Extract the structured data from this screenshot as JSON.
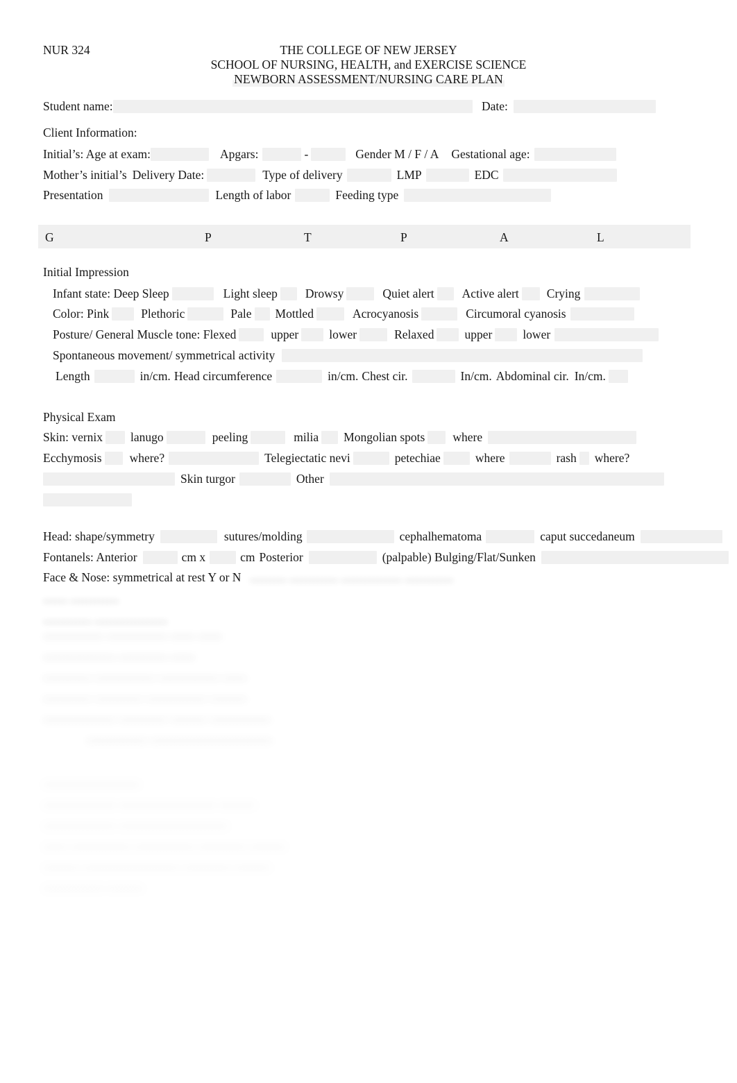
{
  "document": {
    "course_code": "NUR 324",
    "institution": "THE COLLEGE OF NEW JERSEY",
    "school": "SCHOOL OF NURSING, HEALTH, and EXERCISE SCIENCE",
    "form_title": "NEWBORN ASSESSMENT/NURSING CARE PLAN"
  },
  "student_row": {
    "student_name_label": "Student name:",
    "student_name_value": "",
    "date_label": "Date:",
    "date_value": ""
  },
  "client_information": {
    "heading": "Client Information:",
    "line1": {
      "initials_age_label": "Initial’s: Age at exam:",
      "initials_age_value": "",
      "apgars_label": "Apgars:",
      "apgars_first_value": "",
      "apgars_separator": "-",
      "apgars_second_value": "",
      "gender_label": "Gender M / F / A",
      "gestational_age_label": "Gestational age:",
      "gestational_age_value": ""
    },
    "line2": {
      "mothers_initials_label": "Mother’s initial’s",
      "mothers_initials_value": "",
      "delivery_date_label": "Delivery Date:",
      "delivery_date_value": "",
      "type_of_delivery_label": "Type of delivery",
      "type_of_delivery_value": "",
      "lmp_label": "LMP",
      "lmp_value": "",
      "edc_label": "EDC",
      "edc_value": ""
    },
    "line3": {
      "presentation_label": "Presentation",
      "presentation_value": "",
      "length_of_labor_label": "Length of labor",
      "length_of_labor_value": "",
      "feeding_type_label": "Feeding type",
      "feeding_type_value": ""
    }
  },
  "gptpal": {
    "g_label": "G",
    "p1_label": "P",
    "t_label": "T",
    "p2_label": "P",
    "a_label": "A",
    "l_label": "L",
    "g_value": "",
    "p1_value": "",
    "t_value": "",
    "p2_value": "",
    "a_value": "",
    "l_value": ""
  },
  "initial_impression": {
    "heading": "Initial Impression",
    "infant_state": {
      "label": "Infant state: Deep Sleep",
      "options": [
        "Light sleep",
        "Drowsy",
        "Quiet alert",
        "Active alert",
        "Crying"
      ]
    },
    "color": {
      "label": "Color: Pink",
      "options": [
        "Plethoric",
        "Pale",
        "Mottled",
        "Acrocyanosis",
        "Circumoral cyanosis"
      ]
    },
    "posture": {
      "label": "Posture/ General Muscle tone: Flexed",
      "options": [
        "upper",
        "lower",
        "Relaxed",
        "upper",
        "lower"
      ]
    },
    "spontaneous": {
      "label": "Spontaneous movement/ symmetrical activity",
      "value": ""
    },
    "measurements": {
      "length_label": "Length",
      "length_unit": "in/cm.",
      "head_circ_label": "Head circumference",
      "head_circ_unit": "in/cm.",
      "chest_cir_label": "Chest cir.",
      "chest_cir_unit": "In/cm.",
      "abdominal_cir_label": "Abdominal cir.",
      "abdominal_cir_unit": "In/cm."
    }
  },
  "physical_exam": {
    "heading": "Physical Exam",
    "skin_line1": {
      "label": "Skin: vernix",
      "lanugo": "lanugo",
      "peeling": "peeling",
      "milia": "milia",
      "mongolian_spots": "Mongolian spots",
      "where": "where"
    },
    "skin_line2": {
      "ecchymosis": "Ecchymosis",
      "where1": "where?",
      "telegiectatic_nevi": "Telegiectatic nevi",
      "petechiae": "petechiae",
      "where2": "where",
      "rash": "rash",
      "where3": "where?"
    },
    "skin_line3": {
      "skin_turgor": "Skin turgor",
      "other": "Other"
    },
    "head_line": {
      "label": "Head: shape/symmetry",
      "sutures_molding": "sutures/molding",
      "cephalhematoma": "cephalhematoma",
      "caput_succedaneum": "caput succedaneum"
    },
    "fontanels_line": {
      "label": "Fontanels: Anterior",
      "cm_x": "cm x",
      "cm": "cm",
      "posterior": "Posterior",
      "palpable_options": "(palpable) Bulging/Flat/Sunken"
    },
    "face_nose_line": {
      "label": "Face & Nose: symmetrical at rest Y or N"
    }
  },
  "obscured_region": {
    "note": "Remainder of the form below the Face & Nose line is out of focus and illegible.",
    "placeholder_lines": [
      "………  …………  ……………  …………",
      "……  …………",
      "…………  ………………",
      "……………  ……………  ……  ……",
      "………………  …………  ……",
      "…………  ……………  ……………  ……",
      "…………  …………  ……………  ………",
      "………………  …………  ………  ……………",
      "……………  …………………………",
      "……………………",
      "………………  ……………………  ………",
      "………………  ………………………",
      "……  ……………  ……………  …………  ………",
      "………  ……………………  …………  ………",
      "……………  ………"
    ]
  },
  "colors": {
    "page_background": "#ffffff",
    "text": "#181818",
    "form_field_shading": "#f0f0f0"
  }
}
